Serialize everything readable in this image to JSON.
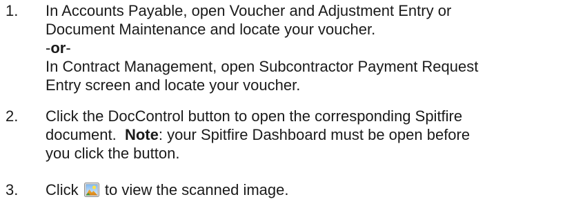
{
  "steps": [
    {
      "number": "1.",
      "line1": "In Accounts Payable, open Voucher and Adjustment Entry or",
      "line2": "Document Maintenance and locate your voucher.",
      "or_prefix": "-",
      "or_word": "or",
      "or_suffix": "-",
      "line3": "In Contract Management, open Subcontractor Payment Request",
      "line4": "Entry screen and locate your voucher."
    },
    {
      "number": "2.",
      "line1": "Click the DocControl button to open the corresponding Spitfire",
      "line2_pre": "document.  ",
      "note_label": "Note",
      "line2_post": ": your Spitfire Dashboard must be open before",
      "line3": "you click the button."
    },
    {
      "number": "3.",
      "text_before_icon": "Click ",
      "icon": "scanned-image-icon",
      "text_after_icon": " to view the scanned image."
    }
  ]
}
